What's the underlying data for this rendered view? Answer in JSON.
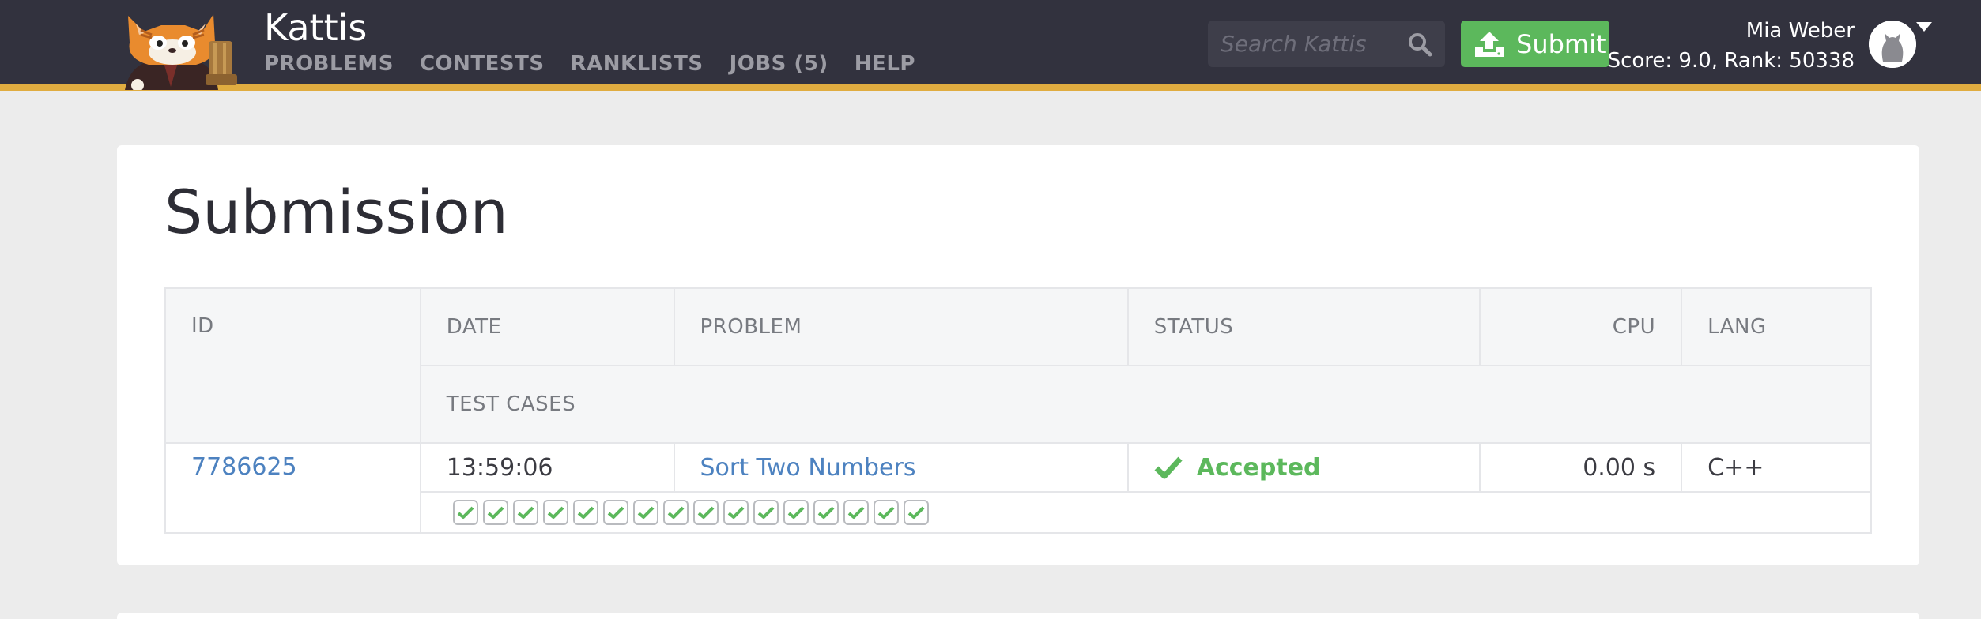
{
  "header": {
    "brand": "Kattis",
    "nav": [
      "PROBLEMS",
      "CONTESTS",
      "RANKLISTS",
      "JOBS (5)",
      "HELP"
    ],
    "search": {
      "placeholder": "Search Kattis",
      "value": ""
    },
    "submit_label": "Submit",
    "user": {
      "name": "Mia Weber",
      "score_line": "Score: 9.0, Rank: 50338"
    }
  },
  "page": {
    "title": "Submission"
  },
  "table": {
    "headers": {
      "id": "ID",
      "date": "DATE",
      "problem": "PROBLEM",
      "status": "STATUS",
      "cpu": "CPU",
      "lang": "LANG",
      "test_cases": "TEST CASES"
    },
    "row": {
      "id": "7786625",
      "date": "13:59:06",
      "problem": "Sort Two Numbers",
      "status": "Accepted",
      "cpu": "0.00 s",
      "lang": "C++",
      "test_cases_passed": 16,
      "test_cases_total": 16
    }
  },
  "colors": {
    "topbar": "#32323e",
    "accent_stripe": "#e0ac40",
    "success": "#5cb85c",
    "link": "#4d82c0"
  }
}
